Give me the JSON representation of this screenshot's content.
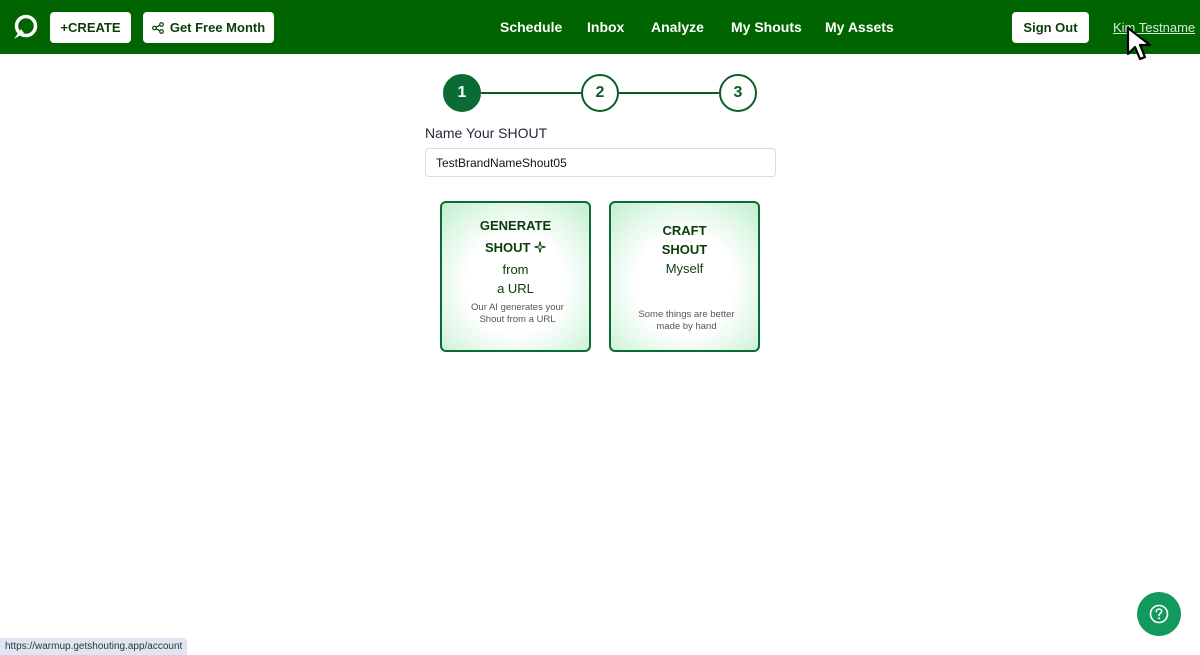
{
  "header": {
    "create_label": "+CREATE",
    "free_month_label": "Get Free Month",
    "nav": [
      "Schedule",
      "Inbox",
      "Analyze",
      "My Shouts",
      "My Assets"
    ],
    "sign_out_label": "Sign Out",
    "user_name": "Kim Testname"
  },
  "steps": [
    "1",
    "2",
    "3"
  ],
  "active_step": 1,
  "form": {
    "name_label": "Name Your SHOUT",
    "name_value": "TestBrandNameShout05"
  },
  "cards": {
    "ai": {
      "line1": "GENERATE",
      "line2": "SHOUT",
      "line3": "from",
      "line4": "a URL",
      "desc": "Our AI generates your Shout from a URL"
    },
    "craft": {
      "line1": "CRAFT",
      "line2": "SHOUT",
      "line3": "Myself",
      "desc": "Some things are better made by hand"
    }
  },
  "status_bar_url": "https://warmup.getshouting.app/account",
  "colors": {
    "brand_green": "#006400",
    "accent_green": "#0b6b35",
    "help_button": "#129a5e"
  },
  "icons": [
    "app-logo-icon",
    "share-icon",
    "sparkle-icon",
    "help-icon",
    "mouse-cursor-icon"
  ]
}
